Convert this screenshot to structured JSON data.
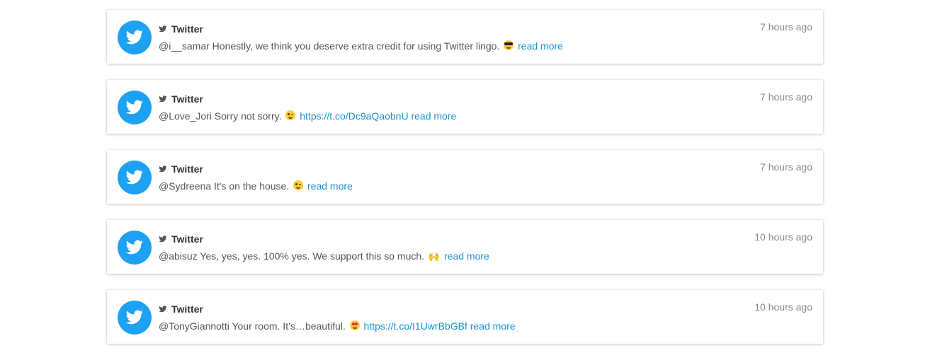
{
  "tweets": [
    {
      "source": "Twitter",
      "time": "7 hours ago",
      "text": "@i__samar Honestly, we think you deserve extra credit for using Twitter lingo.",
      "emoji": "sunglasses-emoji",
      "url": "",
      "read_more": "read more"
    },
    {
      "source": "Twitter",
      "time": "7 hours ago",
      "text": "@Love_Jori Sorry not sorry.",
      "emoji": "wink-emoji",
      "url": "https://t.co/Dc9aQaobnU",
      "read_more": "read more"
    },
    {
      "source": "Twitter",
      "time": "7 hours ago",
      "text": "@Sydreena It's on the house.",
      "emoji": "wink-emoji",
      "url": "",
      "read_more": "read more"
    },
    {
      "source": "Twitter",
      "time": "10 hours ago",
      "text": "@abisuz Yes, yes, yes. 100% yes. We support this so much.",
      "emoji": "raised-hands-emoji",
      "url": "",
      "read_more": "read more"
    },
    {
      "source": "Twitter",
      "time": "10 hours ago",
      "text": "@TonyGiannotti Your room. It’s…beautiful.",
      "emoji": "heart-eyes-emoji",
      "url": "https://t.co/I1UwrBbGBf",
      "read_more": "read more"
    }
  ],
  "colors": {
    "twitter_blue": "#1da1f2",
    "link": "#1b8fd0",
    "muted": "#888888"
  }
}
